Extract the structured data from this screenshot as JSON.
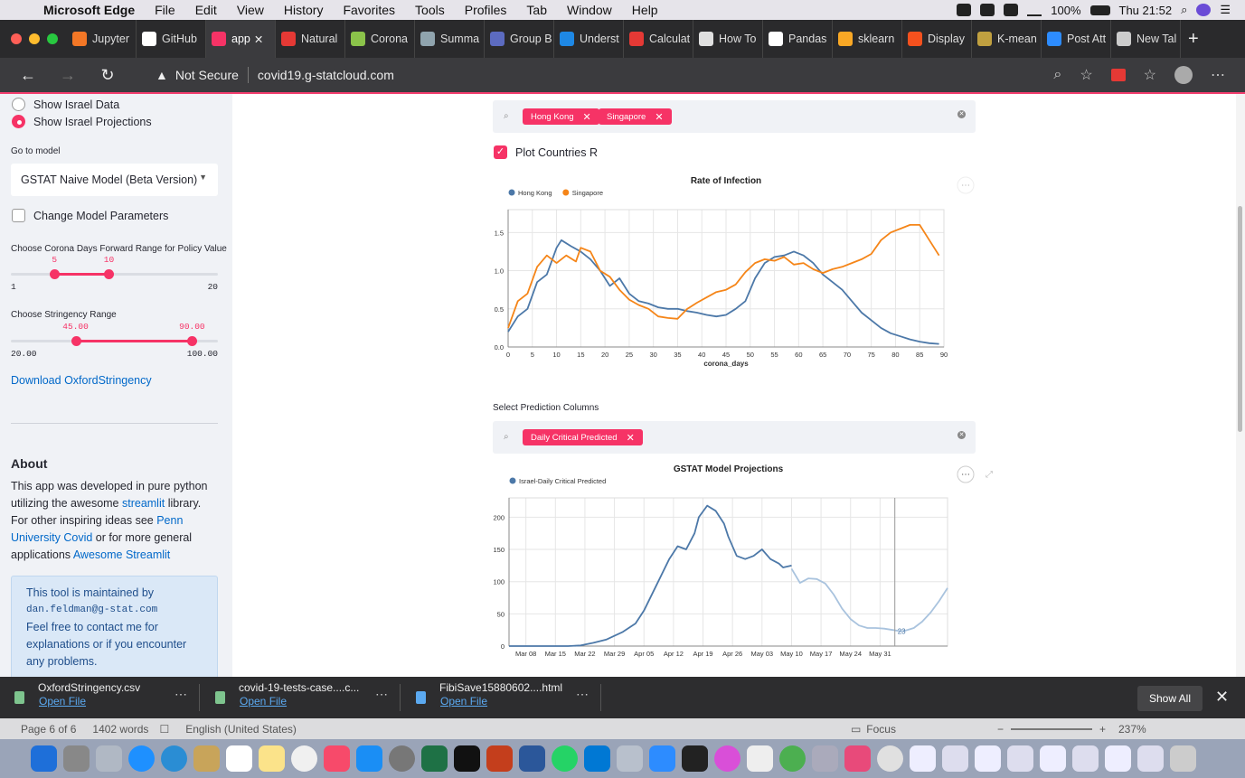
{
  "menubar": {
    "app": "Microsoft Edge",
    "items": [
      "File",
      "Edit",
      "View",
      "History",
      "Favorites",
      "Tools",
      "Profiles",
      "Tab",
      "Window",
      "Help"
    ],
    "battery": "100%",
    "clock": "Thu 21:52"
  },
  "tabs": [
    {
      "label": "Jupyter",
      "color": "#f37726"
    },
    {
      "label": "GitHub",
      "color": "#ffffff"
    },
    {
      "label": "app",
      "color": "#f63366",
      "active": true
    },
    {
      "label": "Natural",
      "color": "#e53935"
    },
    {
      "label": "Corona",
      "color": "#8bc34a"
    },
    {
      "label": "Summa",
      "color": "#90a4ae"
    },
    {
      "label": "Group B",
      "color": "#5c6bc0"
    },
    {
      "label": "Underst",
      "color": "#1e88e5"
    },
    {
      "label": "Calculat",
      "color": "#e53935"
    },
    {
      "label": "How To",
      "color": "#e0e0e0"
    },
    {
      "label": "Pandas",
      "color": "#ffffff"
    },
    {
      "label": "sklearn",
      "color": "#f9a825"
    },
    {
      "label": "Display",
      "color": "#f4511e"
    },
    {
      "label": "K-mean",
      "color": "#c0a040"
    },
    {
      "label": "Post Att",
      "color": "#2d8cff"
    },
    {
      "label": "New Tal",
      "color": "#cccccc"
    }
  ],
  "address": {
    "security": "Not Secure",
    "url": "covid19.g-statcloud.com"
  },
  "sidebar": {
    "radio1": "Show Israel Data",
    "radio2": "Show Israel Projections",
    "goto_label": "Go to model",
    "model_select": "GSTAT Naive Model (Beta Version)",
    "change_params": "Change Model Parameters",
    "slider1": {
      "label": "Choose Corona Days Forward Range for Policy Value",
      "low": "5",
      "high": "10",
      "min": "1",
      "max": "20",
      "low_frac": 0.2105,
      "high_frac": 0.4737
    },
    "slider2": {
      "label": "Choose Stringency Range",
      "low": "45.00",
      "high": "90.00",
      "min": "20.00",
      "max": "100.00",
      "low_frac": 0.3125,
      "high_frac": 0.875
    },
    "download_link": "Download OxfordStringency",
    "about_title": "About",
    "about_1": "This app was developed in pure python utilizing the awesome ",
    "about_link1": "streamlit",
    "about_2": " library. For other inspiring ideas see ",
    "about_link2": "Penn University Covid",
    "about_3": " or for more general applications ",
    "about_link3": "Awesome Streamlit",
    "info_1": "This tool is maintained by",
    "info_email": "dan.feldman@g-stat.com",
    "info_2": "Feel free to contact me for explanations or if you encounter any problems."
  },
  "main": {
    "countries_chips": [
      "Hong Kong",
      "Singapore"
    ],
    "plot_check": "Plot Countries R",
    "prediction_title": "Select Prediction Columns",
    "prediction_chips": [
      "Daily Critical Predicted"
    ]
  },
  "chart_data": [
    {
      "type": "line",
      "title": "Rate of Infection",
      "xlabel": "corona_days",
      "ylabel": "",
      "xlim": [
        0,
        90
      ],
      "ylim": [
        0,
        1.8
      ],
      "xticks": [
        0,
        5,
        10,
        15,
        20,
        25,
        30,
        35,
        40,
        45,
        50,
        55,
        60,
        65,
        70,
        75,
        80,
        85,
        90
      ],
      "yticks": [
        0.0,
        0.5,
        1.0,
        1.5
      ],
      "legend": "top-left",
      "series": [
        {
          "name": "Hong Kong",
          "color": "#4c78a8",
          "x": [
            0,
            2,
            4,
            6,
            8,
            10,
            11,
            13,
            15,
            17,
            19,
            21,
            23,
            25,
            27,
            29,
            31,
            33,
            35,
            37,
            39,
            41,
            43,
            45,
            47,
            49,
            51,
            53,
            55,
            57,
            59,
            61,
            63,
            65,
            67,
            69,
            71,
            73,
            75,
            77,
            79,
            81,
            83,
            85,
            87,
            89
          ],
          "y": [
            0.2,
            0.4,
            0.5,
            0.85,
            0.95,
            1.3,
            1.4,
            1.32,
            1.25,
            1.15,
            1.0,
            0.8,
            0.9,
            0.7,
            0.6,
            0.57,
            0.52,
            0.5,
            0.5,
            0.47,
            0.45,
            0.42,
            0.4,
            0.42,
            0.5,
            0.6,
            0.9,
            1.1,
            1.18,
            1.2,
            1.25,
            1.2,
            1.1,
            0.95,
            0.85,
            0.75,
            0.6,
            0.45,
            0.35,
            0.25,
            0.18,
            0.14,
            0.1,
            0.07,
            0.05,
            0.04
          ]
        },
        {
          "name": "Singapore",
          "color": "#f58518",
          "x": [
            0,
            2,
            4,
            6,
            8,
            10,
            12,
            14,
            15,
            17,
            19,
            21,
            23,
            25,
            27,
            29,
            31,
            33,
            35,
            37,
            39,
            41,
            43,
            45,
            47,
            49,
            51,
            53,
            55,
            57,
            59,
            61,
            63,
            65,
            67,
            69,
            71,
            73,
            75,
            77,
            79,
            81,
            83,
            85,
            87,
            89
          ],
          "y": [
            0.25,
            0.6,
            0.7,
            1.05,
            1.2,
            1.1,
            1.2,
            1.12,
            1.3,
            1.25,
            1.0,
            0.92,
            0.75,
            0.62,
            0.55,
            0.5,
            0.4,
            0.38,
            0.37,
            0.5,
            0.58,
            0.65,
            0.72,
            0.75,
            0.82,
            0.98,
            1.1,
            1.15,
            1.13,
            1.18,
            1.08,
            1.1,
            1.02,
            0.97,
            1.02,
            1.05,
            1.1,
            1.15,
            1.22,
            1.4,
            1.5,
            1.55,
            1.6,
            1.6,
            1.4,
            1.2
          ]
        }
      ]
    },
    {
      "type": "line",
      "title": "GSTAT Model Projections",
      "xlabel": "",
      "ylabel": "",
      "ylim": [
        0,
        230
      ],
      "xticks": [
        "Mar 08",
        "Mar 15",
        "Mar 22",
        "Mar 29",
        "Apr 05",
        "Apr 12",
        "Apr 19",
        "Apr 26",
        "May 03",
        "May 10",
        "May 17",
        "May 24",
        "May 31"
      ],
      "yticks": [
        0,
        50,
        100,
        150,
        200
      ],
      "legend": "top-left",
      "annotation": "23",
      "series": [
        {
          "name": "Israel-Daily Critical Predicted",
          "color": "#4c78a8",
          "x": [
            0,
            7,
            14,
            17,
            20,
            23,
            27,
            30,
            32,
            35,
            38,
            40,
            42,
            44,
            45,
            47,
            49,
            51,
            52,
            54,
            56,
            58,
            60,
            62,
            64,
            65,
            67
          ],
          "y": [
            0,
            0,
            0,
            1,
            5,
            10,
            22,
            35,
            55,
            95,
            135,
            155,
            150,
            175,
            200,
            218,
            210,
            190,
            170,
            140,
            135,
            140,
            150,
            135,
            128,
            122,
            125
          ]
        },
        {
          "name": "Israel-Daily Critical Predicted (projection)",
          "color": "#a9c3de",
          "x": [
            67,
            69,
            71,
            73,
            75,
            77,
            79,
            81,
            83,
            85,
            87,
            89,
            91,
            93,
            94,
            96,
            98,
            100,
            102,
            104
          ],
          "y": [
            120,
            98,
            105,
            104,
            97,
            80,
            58,
            42,
            32,
            28,
            28,
            27,
            25,
            23,
            24,
            28,
            38,
            52,
            70,
            90
          ]
        }
      ],
      "x_start": "Mar 08",
      "x_days_span": 87
    }
  ],
  "downloads": [
    {
      "name": "OxfordStringency.csv",
      "action": "Open File"
    },
    {
      "name": "covid-19-tests-case....c...",
      "action": "Open File"
    },
    {
      "name": "FibiSave15880602....html",
      "action": "Open File"
    }
  ],
  "downloads_show_all": "Show All",
  "statusbar": {
    "page": "Page 6 of 6",
    "words": "1402 words",
    "lang": "English (United States)",
    "focus": "Focus",
    "zoom": "237%"
  }
}
